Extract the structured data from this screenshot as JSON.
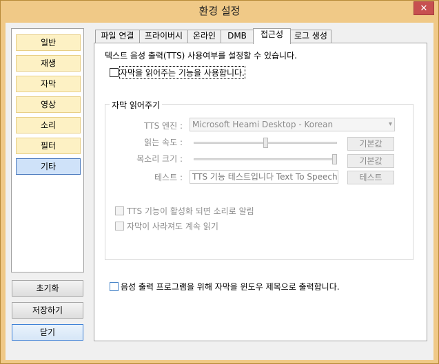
{
  "window": {
    "title": "환경 설정",
    "close_glyph": "✕"
  },
  "sidebar": {
    "items": [
      {
        "label": "일반"
      },
      {
        "label": "재생"
      },
      {
        "label": "자막"
      },
      {
        "label": "영상"
      },
      {
        "label": "소리"
      },
      {
        "label": "필터"
      },
      {
        "label": "기타",
        "selected": true
      }
    ]
  },
  "buttons": {
    "reset": "초기화",
    "save": "저장하기",
    "close": "닫기"
  },
  "tabs": [
    {
      "label": "파일 연결"
    },
    {
      "label": "프라이버시"
    },
    {
      "label": "온라인"
    },
    {
      "label": "DMB"
    },
    {
      "label": "접근성",
      "selected": true
    },
    {
      "label": "로그 생성"
    }
  ],
  "accessibility": {
    "description": "텍스트 음성 출력(TTS) 사용여부를 설정할 수 있습니다.",
    "enable_reader": {
      "label": "자막을 읽어주는 기능을 사용합니다.",
      "checked": false
    },
    "group_title": "자막 읽어주기",
    "tts_engine": {
      "label": "TTS 엔진 :",
      "value": "Microsoft Heami Desktop - Korean"
    },
    "read_speed": {
      "label": "읽는 속도 :",
      "level": 0.5,
      "default_button": "기본값"
    },
    "voice_volume": {
      "label": "목소리 크기 :",
      "level": 1.0,
      "default_button": "기본값"
    },
    "test": {
      "label": "테스트 :",
      "value": "TTS 기능 테스트입니다 Text To Speech",
      "button": "테스트"
    },
    "notify_on_activate": {
      "label": "TTS 기능이 활성화 되면 소리로 알림",
      "checked": false
    },
    "keep_reading": {
      "label": "자막이 사라져도 계속 읽기",
      "checked": false
    },
    "output_to_title": {
      "label": "음성 출력 프로그램을 위해 자막을 윈도우 제목으로 출력합니다.",
      "checked": false
    }
  },
  "colors": {
    "frame": "#f0c987",
    "close": "#c75050",
    "selected_item": "#cfe2f9",
    "sidebar_item": "#fdf1c4"
  }
}
